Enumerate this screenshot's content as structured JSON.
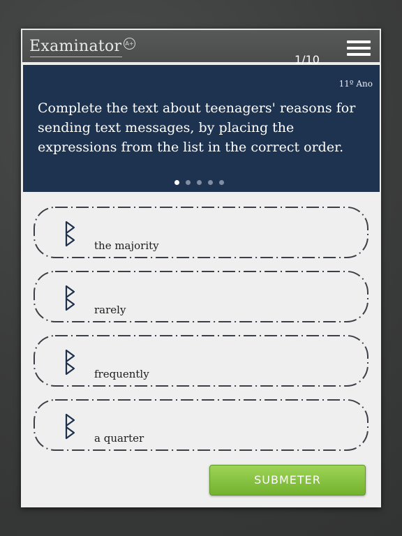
{
  "header": {
    "app_name": "Examinator",
    "badge": "A+",
    "counter": "1/10",
    "menu_icon": "hamburger-menu-icon"
  },
  "question": {
    "grade": "11º Ano",
    "text": "Complete the text about teenagers' reasons for sending text messages, by placing the expressions from the list in the correct order.",
    "pages_total": 5,
    "page_active": 1
  },
  "items": [
    {
      "label": "the majority",
      "handle_icon": "drag-handle-icon"
    },
    {
      "label": "rarely",
      "handle_icon": "drag-handle-icon"
    },
    {
      "label": "frequently",
      "handle_icon": "drag-handle-icon"
    },
    {
      "label": "a quarter",
      "handle_icon": "drag-handle-icon"
    }
  ],
  "submit": {
    "label": "SUBMETER"
  },
  "colors": {
    "question_bg": "#1e3350",
    "header_bg": "#505151",
    "button_green": "#84c13f",
    "page_bg": "#3e3f3f"
  }
}
